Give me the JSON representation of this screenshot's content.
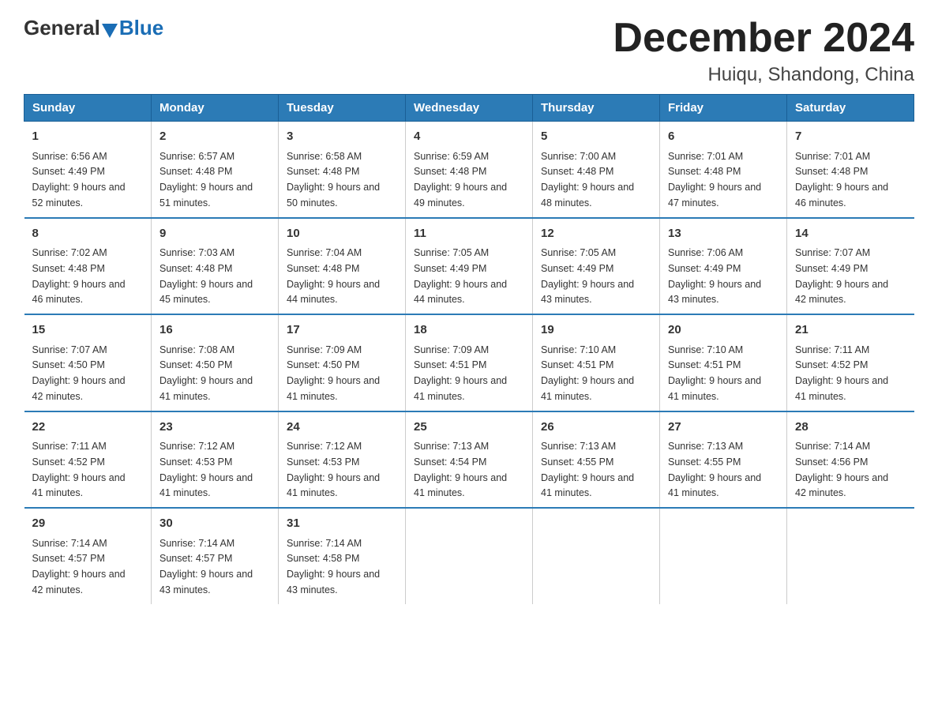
{
  "header": {
    "logo_general": "General",
    "logo_blue": "Blue",
    "month_title": "December 2024",
    "location": "Huiqu, Shandong, China"
  },
  "days_of_week": [
    "Sunday",
    "Monday",
    "Tuesday",
    "Wednesday",
    "Thursday",
    "Friday",
    "Saturday"
  ],
  "weeks": [
    [
      {
        "day": "1",
        "sunrise": "6:56 AM",
        "sunset": "4:49 PM",
        "daylight": "9 hours and 52 minutes."
      },
      {
        "day": "2",
        "sunrise": "6:57 AM",
        "sunset": "4:48 PM",
        "daylight": "9 hours and 51 minutes."
      },
      {
        "day": "3",
        "sunrise": "6:58 AM",
        "sunset": "4:48 PM",
        "daylight": "9 hours and 50 minutes."
      },
      {
        "day": "4",
        "sunrise": "6:59 AM",
        "sunset": "4:48 PM",
        "daylight": "9 hours and 49 minutes."
      },
      {
        "day": "5",
        "sunrise": "7:00 AM",
        "sunset": "4:48 PM",
        "daylight": "9 hours and 48 minutes."
      },
      {
        "day": "6",
        "sunrise": "7:01 AM",
        "sunset": "4:48 PM",
        "daylight": "9 hours and 47 minutes."
      },
      {
        "day": "7",
        "sunrise": "7:01 AM",
        "sunset": "4:48 PM",
        "daylight": "9 hours and 46 minutes."
      }
    ],
    [
      {
        "day": "8",
        "sunrise": "7:02 AM",
        "sunset": "4:48 PM",
        "daylight": "9 hours and 46 minutes."
      },
      {
        "day": "9",
        "sunrise": "7:03 AM",
        "sunset": "4:48 PM",
        "daylight": "9 hours and 45 minutes."
      },
      {
        "day": "10",
        "sunrise": "7:04 AM",
        "sunset": "4:48 PM",
        "daylight": "9 hours and 44 minutes."
      },
      {
        "day": "11",
        "sunrise": "7:05 AM",
        "sunset": "4:49 PM",
        "daylight": "9 hours and 44 minutes."
      },
      {
        "day": "12",
        "sunrise": "7:05 AM",
        "sunset": "4:49 PM",
        "daylight": "9 hours and 43 minutes."
      },
      {
        "day": "13",
        "sunrise": "7:06 AM",
        "sunset": "4:49 PM",
        "daylight": "9 hours and 43 minutes."
      },
      {
        "day": "14",
        "sunrise": "7:07 AM",
        "sunset": "4:49 PM",
        "daylight": "9 hours and 42 minutes."
      }
    ],
    [
      {
        "day": "15",
        "sunrise": "7:07 AM",
        "sunset": "4:50 PM",
        "daylight": "9 hours and 42 minutes."
      },
      {
        "day": "16",
        "sunrise": "7:08 AM",
        "sunset": "4:50 PM",
        "daylight": "9 hours and 41 minutes."
      },
      {
        "day": "17",
        "sunrise": "7:09 AM",
        "sunset": "4:50 PM",
        "daylight": "9 hours and 41 minutes."
      },
      {
        "day": "18",
        "sunrise": "7:09 AM",
        "sunset": "4:51 PM",
        "daylight": "9 hours and 41 minutes."
      },
      {
        "day": "19",
        "sunrise": "7:10 AM",
        "sunset": "4:51 PM",
        "daylight": "9 hours and 41 minutes."
      },
      {
        "day": "20",
        "sunrise": "7:10 AM",
        "sunset": "4:51 PM",
        "daylight": "9 hours and 41 minutes."
      },
      {
        "day": "21",
        "sunrise": "7:11 AM",
        "sunset": "4:52 PM",
        "daylight": "9 hours and 41 minutes."
      }
    ],
    [
      {
        "day": "22",
        "sunrise": "7:11 AM",
        "sunset": "4:52 PM",
        "daylight": "9 hours and 41 minutes."
      },
      {
        "day": "23",
        "sunrise": "7:12 AM",
        "sunset": "4:53 PM",
        "daylight": "9 hours and 41 minutes."
      },
      {
        "day": "24",
        "sunrise": "7:12 AM",
        "sunset": "4:53 PM",
        "daylight": "9 hours and 41 minutes."
      },
      {
        "day": "25",
        "sunrise": "7:13 AM",
        "sunset": "4:54 PM",
        "daylight": "9 hours and 41 minutes."
      },
      {
        "day": "26",
        "sunrise": "7:13 AM",
        "sunset": "4:55 PM",
        "daylight": "9 hours and 41 minutes."
      },
      {
        "day": "27",
        "sunrise": "7:13 AM",
        "sunset": "4:55 PM",
        "daylight": "9 hours and 41 minutes."
      },
      {
        "day": "28",
        "sunrise": "7:14 AM",
        "sunset": "4:56 PM",
        "daylight": "9 hours and 42 minutes."
      }
    ],
    [
      {
        "day": "29",
        "sunrise": "7:14 AM",
        "sunset": "4:57 PM",
        "daylight": "9 hours and 42 minutes."
      },
      {
        "day": "30",
        "sunrise": "7:14 AM",
        "sunset": "4:57 PM",
        "daylight": "9 hours and 43 minutes."
      },
      {
        "day": "31",
        "sunrise": "7:14 AM",
        "sunset": "4:58 PM",
        "daylight": "9 hours and 43 minutes."
      },
      null,
      null,
      null,
      null
    ]
  ],
  "labels": {
    "sunrise_prefix": "Sunrise: ",
    "sunset_prefix": "Sunset: ",
    "daylight_prefix": "Daylight: "
  }
}
